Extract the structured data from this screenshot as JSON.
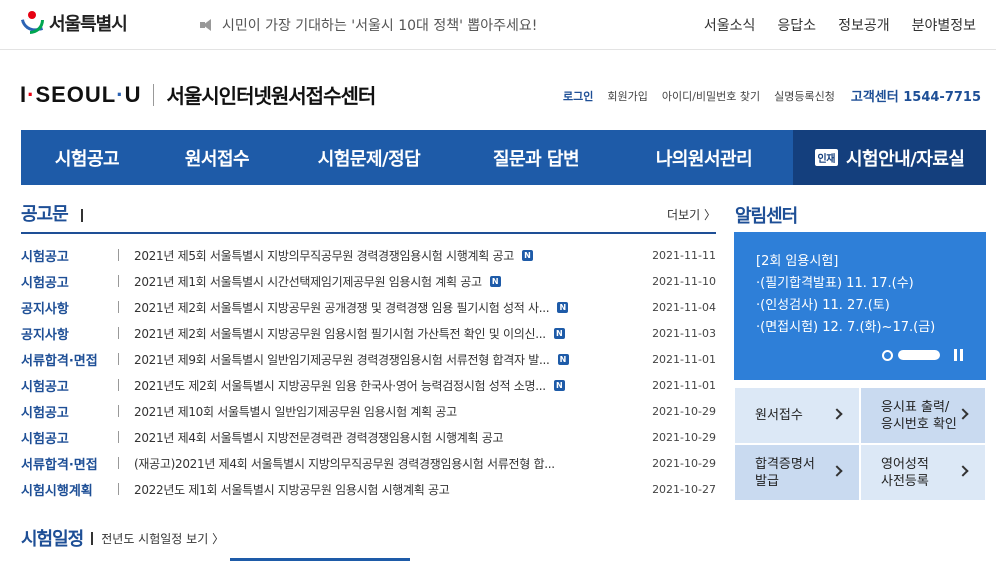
{
  "top": {
    "seoul_name": "서울특별시",
    "ticker": "시민이 가장 기대하는 '서울시 10대 정책' 뽑아주세요!",
    "links": [
      "서울소식",
      "응답소",
      "정보공개",
      "분야별정보"
    ]
  },
  "brand": {
    "logo_i": "I",
    "logo_seoul": "SEOUL",
    "logo_u": "U",
    "title": "서울시인터넷원서접수센터"
  },
  "member": {
    "login": "로그인",
    "join": "회원가입",
    "find": "아이디/비밀번호 찾기",
    "realname": "실명등록신청",
    "callcenter": "고객센터 1544-7715"
  },
  "gnb": {
    "items": [
      "시험공고",
      "원서접수",
      "시험문제/정답",
      "질문과 답변",
      "나의원서관리",
      "시험안내/자료실"
    ],
    "tag": "인재"
  },
  "notices": {
    "title": "공고문",
    "more": "더보기",
    "rows": [
      {
        "cat": "시험공고",
        "subject": "2021년 제5회 서울특별시 지방의무직공무원 경력경쟁임용시험 시행계획 공고",
        "new": true,
        "date": "2021-11-11"
      },
      {
        "cat": "시험공고",
        "subject": "2021년 제1회 서울특별시 시간선택제임기제공무원 임용시험 계획 공고",
        "new": true,
        "date": "2021-11-10"
      },
      {
        "cat": "공지사항",
        "subject": "2021년 제2회 서울특별시 지방공무원 공개경쟁 및 경력경쟁 임용 필기시험 성적 사...",
        "new": true,
        "date": "2021-11-04"
      },
      {
        "cat": "공지사항",
        "subject": "2021년 제2회 서울특별시 지방공무원 임용시험 필기시험 가산특전 확인 및 이의신...",
        "new": true,
        "date": "2021-11-03"
      },
      {
        "cat": "서류합격·면접",
        "subject": "2021년 제9회 서울특별시 일반임기제공무원 경력경쟁임용시험 서류전형 합격자 발...",
        "new": true,
        "date": "2021-11-01"
      },
      {
        "cat": "시험공고",
        "subject": "2021년도 제2회 서울특별시 지방공무원 임용 한국사·영어 능력검정시험 성적 소명...",
        "new": true,
        "date": "2021-11-01"
      },
      {
        "cat": "시험공고",
        "subject": "2021년 제10회 서울특별시 일반임기제공무원 임용시험 계획 공고",
        "new": false,
        "date": "2021-10-29"
      },
      {
        "cat": "시험공고",
        "subject": "2021년 제4회 서울특별시 지방전문경력관 경력경쟁임용시험 시행계획 공고",
        "new": false,
        "date": "2021-10-29"
      },
      {
        "cat": "서류합격·면접",
        "subject": "(재공고)2021년 제4회 서울특별시 지방의무직공무원 경력경쟁임용시험 서류전형 합...",
        "new": false,
        "date": "2021-10-29"
      },
      {
        "cat": "시험시행계획",
        "subject": "2022년도 제1회 서울특별시 지방공무원 임용시험 시행계획 공고",
        "new": false,
        "date": "2021-10-27"
      }
    ]
  },
  "schedule": {
    "title": "시험일정",
    "link": "전년도 시험일정 보기"
  },
  "alarm": {
    "title": "알림센터",
    "lines": [
      "[2회 임용시험]",
      "·(필기합격발표) 11. 17.(수)",
      "·(인성검사) 11. 27.(토)",
      "·(면접시험) 12. 7.(화)~17.(금)"
    ],
    "quick": [
      "원서접수",
      "응시표 출력/\n응시번호 확인",
      "합격증명서\n발급",
      "영어성적\n사전등록"
    ]
  },
  "colors": {
    "primary": "#1e5ba8",
    "dark": "#143f7d",
    "alarm": "#2e7fd8"
  }
}
